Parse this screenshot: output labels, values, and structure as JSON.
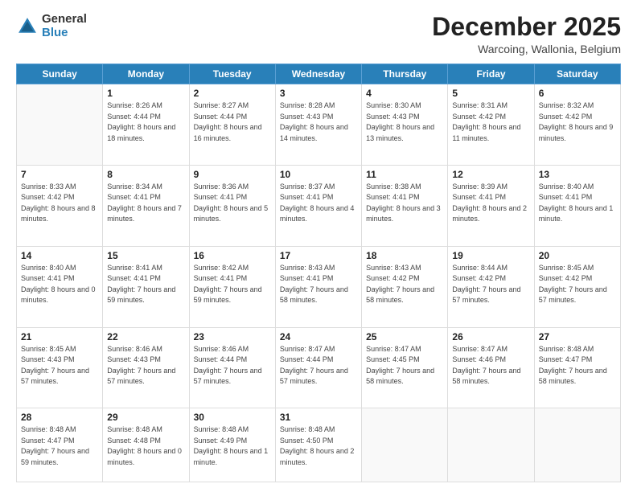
{
  "logo": {
    "general": "General",
    "blue": "Blue"
  },
  "header": {
    "month": "December 2025",
    "location": "Warcoing, Wallonia, Belgium"
  },
  "weekdays": [
    "Sunday",
    "Monday",
    "Tuesday",
    "Wednesday",
    "Thursday",
    "Friday",
    "Saturday"
  ],
  "weeks": [
    [
      {
        "day": "",
        "sunrise": "",
        "sunset": "",
        "daylight": ""
      },
      {
        "day": "1",
        "sunrise": "Sunrise: 8:26 AM",
        "sunset": "Sunset: 4:44 PM",
        "daylight": "Daylight: 8 hours and 18 minutes."
      },
      {
        "day": "2",
        "sunrise": "Sunrise: 8:27 AM",
        "sunset": "Sunset: 4:44 PM",
        "daylight": "Daylight: 8 hours and 16 minutes."
      },
      {
        "day": "3",
        "sunrise": "Sunrise: 8:28 AM",
        "sunset": "Sunset: 4:43 PM",
        "daylight": "Daylight: 8 hours and 14 minutes."
      },
      {
        "day": "4",
        "sunrise": "Sunrise: 8:30 AM",
        "sunset": "Sunset: 4:43 PM",
        "daylight": "Daylight: 8 hours and 13 minutes."
      },
      {
        "day": "5",
        "sunrise": "Sunrise: 8:31 AM",
        "sunset": "Sunset: 4:42 PM",
        "daylight": "Daylight: 8 hours and 11 minutes."
      },
      {
        "day": "6",
        "sunrise": "Sunrise: 8:32 AM",
        "sunset": "Sunset: 4:42 PM",
        "daylight": "Daylight: 8 hours and 9 minutes."
      }
    ],
    [
      {
        "day": "7",
        "sunrise": "Sunrise: 8:33 AM",
        "sunset": "Sunset: 4:42 PM",
        "daylight": "Daylight: 8 hours and 8 minutes."
      },
      {
        "day": "8",
        "sunrise": "Sunrise: 8:34 AM",
        "sunset": "Sunset: 4:41 PM",
        "daylight": "Daylight: 8 hours and 7 minutes."
      },
      {
        "day": "9",
        "sunrise": "Sunrise: 8:36 AM",
        "sunset": "Sunset: 4:41 PM",
        "daylight": "Daylight: 8 hours and 5 minutes."
      },
      {
        "day": "10",
        "sunrise": "Sunrise: 8:37 AM",
        "sunset": "Sunset: 4:41 PM",
        "daylight": "Daylight: 8 hours and 4 minutes."
      },
      {
        "day": "11",
        "sunrise": "Sunrise: 8:38 AM",
        "sunset": "Sunset: 4:41 PM",
        "daylight": "Daylight: 8 hours and 3 minutes."
      },
      {
        "day": "12",
        "sunrise": "Sunrise: 8:39 AM",
        "sunset": "Sunset: 4:41 PM",
        "daylight": "Daylight: 8 hours and 2 minutes."
      },
      {
        "day": "13",
        "sunrise": "Sunrise: 8:40 AM",
        "sunset": "Sunset: 4:41 PM",
        "daylight": "Daylight: 8 hours and 1 minute."
      }
    ],
    [
      {
        "day": "14",
        "sunrise": "Sunrise: 8:40 AM",
        "sunset": "Sunset: 4:41 PM",
        "daylight": "Daylight: 8 hours and 0 minutes."
      },
      {
        "day": "15",
        "sunrise": "Sunrise: 8:41 AM",
        "sunset": "Sunset: 4:41 PM",
        "daylight": "Daylight: 7 hours and 59 minutes."
      },
      {
        "day": "16",
        "sunrise": "Sunrise: 8:42 AM",
        "sunset": "Sunset: 4:41 PM",
        "daylight": "Daylight: 7 hours and 59 minutes."
      },
      {
        "day": "17",
        "sunrise": "Sunrise: 8:43 AM",
        "sunset": "Sunset: 4:41 PM",
        "daylight": "Daylight: 7 hours and 58 minutes."
      },
      {
        "day": "18",
        "sunrise": "Sunrise: 8:43 AM",
        "sunset": "Sunset: 4:42 PM",
        "daylight": "Daylight: 7 hours and 58 minutes."
      },
      {
        "day": "19",
        "sunrise": "Sunrise: 8:44 AM",
        "sunset": "Sunset: 4:42 PM",
        "daylight": "Daylight: 7 hours and 57 minutes."
      },
      {
        "day": "20",
        "sunrise": "Sunrise: 8:45 AM",
        "sunset": "Sunset: 4:42 PM",
        "daylight": "Daylight: 7 hours and 57 minutes."
      }
    ],
    [
      {
        "day": "21",
        "sunrise": "Sunrise: 8:45 AM",
        "sunset": "Sunset: 4:43 PM",
        "daylight": "Daylight: 7 hours and 57 minutes."
      },
      {
        "day": "22",
        "sunrise": "Sunrise: 8:46 AM",
        "sunset": "Sunset: 4:43 PM",
        "daylight": "Daylight: 7 hours and 57 minutes."
      },
      {
        "day": "23",
        "sunrise": "Sunrise: 8:46 AM",
        "sunset": "Sunset: 4:44 PM",
        "daylight": "Daylight: 7 hours and 57 minutes."
      },
      {
        "day": "24",
        "sunrise": "Sunrise: 8:47 AM",
        "sunset": "Sunset: 4:44 PM",
        "daylight": "Daylight: 7 hours and 57 minutes."
      },
      {
        "day": "25",
        "sunrise": "Sunrise: 8:47 AM",
        "sunset": "Sunset: 4:45 PM",
        "daylight": "Daylight: 7 hours and 58 minutes."
      },
      {
        "day": "26",
        "sunrise": "Sunrise: 8:47 AM",
        "sunset": "Sunset: 4:46 PM",
        "daylight": "Daylight: 7 hours and 58 minutes."
      },
      {
        "day": "27",
        "sunrise": "Sunrise: 8:48 AM",
        "sunset": "Sunset: 4:47 PM",
        "daylight": "Daylight: 7 hours and 58 minutes."
      }
    ],
    [
      {
        "day": "28",
        "sunrise": "Sunrise: 8:48 AM",
        "sunset": "Sunset: 4:47 PM",
        "daylight": "Daylight: 7 hours and 59 minutes."
      },
      {
        "day": "29",
        "sunrise": "Sunrise: 8:48 AM",
        "sunset": "Sunset: 4:48 PM",
        "daylight": "Daylight: 8 hours and 0 minutes."
      },
      {
        "day": "30",
        "sunrise": "Sunrise: 8:48 AM",
        "sunset": "Sunset: 4:49 PM",
        "daylight": "Daylight: 8 hours and 1 minute."
      },
      {
        "day": "31",
        "sunrise": "Sunrise: 8:48 AM",
        "sunset": "Sunset: 4:50 PM",
        "daylight": "Daylight: 8 hours and 2 minutes."
      },
      {
        "day": "",
        "sunrise": "",
        "sunset": "",
        "daylight": ""
      },
      {
        "day": "",
        "sunrise": "",
        "sunset": "",
        "daylight": ""
      },
      {
        "day": "",
        "sunrise": "",
        "sunset": "",
        "daylight": ""
      }
    ]
  ]
}
